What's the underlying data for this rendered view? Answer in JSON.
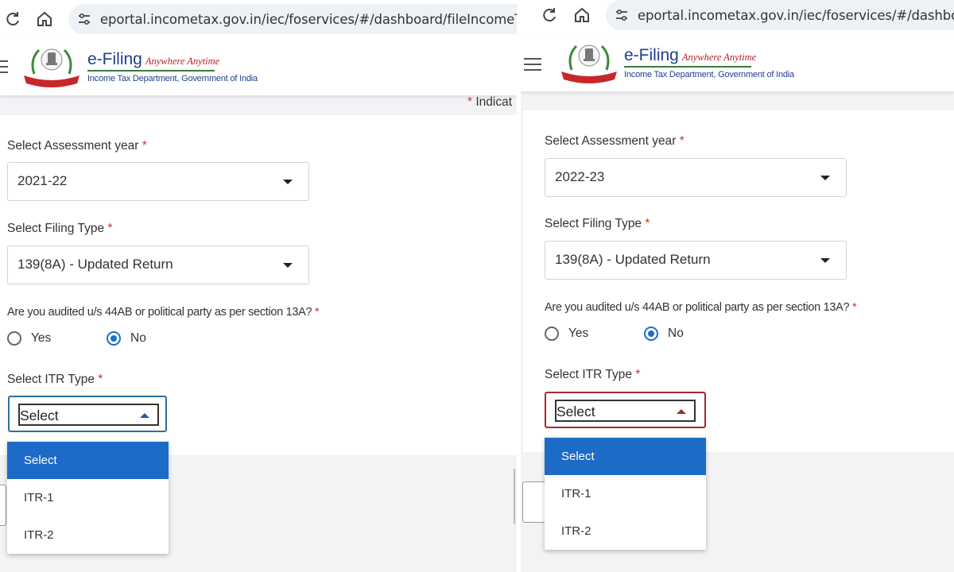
{
  "browser": {
    "left_url": "eportal.incometax.gov.in/iec/foservices/#/dashboard/fileIncomeTaxReturn",
    "right_url": "eportal.incometax.gov.in/iec/foservices/#/dashboard/fileI"
  },
  "header": {
    "brand_title": "e-Filing",
    "brand_tagline": "Anywhere Anytime",
    "brand_subtitle": "Income Tax Department, Government of India",
    "emblem_icon": "income-tax-department-emblem"
  },
  "indicates_text": "Indicat",
  "indicates_star": "*",
  "form_labels": {
    "assessment_year": "Select Assessment year",
    "filing_type": "Select Filing Type",
    "audited_question": "Are you audited u/s 44AB or political party as per section 13A?",
    "itr_type": "Select ITR Type",
    "required_marker": "*"
  },
  "radio_options": {
    "yes": "Yes",
    "no": "No",
    "selected": "No"
  },
  "left_form": {
    "assessment_year_value": "2021-22",
    "filing_type_value": "139(8A) - Updated Return",
    "itr_type_value": "Select"
  },
  "right_form": {
    "assessment_year_value": "2022-23",
    "filing_type_value": "139(8A) - Updated Return",
    "itr_type_value": "Select"
  },
  "itr_options": [
    "Select",
    "ITR-1",
    "ITR-2"
  ],
  "colors": {
    "accent_blue": "#1c6bc6",
    "required_red": "#c0392b",
    "focus_red": "#a62a2a"
  }
}
